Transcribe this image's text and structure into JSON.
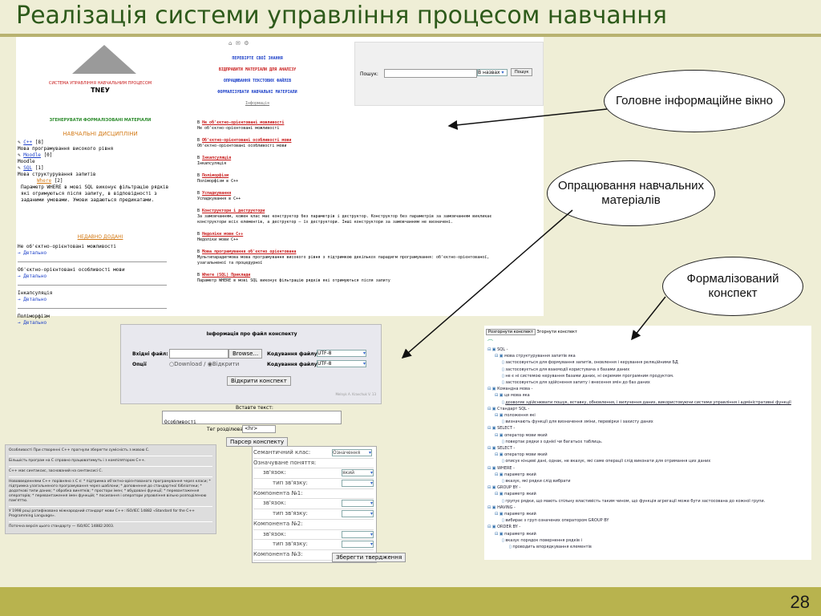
{
  "slide": {
    "title": "Реалізація системи управління процесом навчання",
    "page_number": "28"
  },
  "main_window": {
    "system_title": "СИСТЕМА УПРАВЛІННЯ НАВЧАЛЬНИМ ПРОЦЕСОМ",
    "system_name": "TNEУ",
    "generate_link": "ЗГЕНЕРУВАТИ ФОРМАЛІЗОВАНІ МАТЕРІАЛИ",
    "disciplines_heading": "НАВЧАЛЬНІ ДИСЦИПЛІНИ",
    "disciplines": [
      {
        "name": "C++",
        "count": "[8]",
        "desc": "Мова програмування високого рівня"
      },
      {
        "name": "Moodle",
        "count": "[0]",
        "desc": "Moodle"
      },
      {
        "name": "SQL",
        "count": "[1]",
        "desc": "Мова структурування запитів"
      }
    ],
    "where_title": "Where",
    "where_count": "[2]",
    "where_text": "Параметр WHERE в мові SQL виконує фільтрацію рядків які отримуються після запиту, в відповідності з заданими умовами. Умови задаються предикатами.",
    "recent_heading": "НЕДАВНО ДОДАНІ",
    "recent": [
      "Не об'єктно-орієнтовані можливості",
      "Об'єктно-орієнтовані особливості мови",
      "Інкапсуляція",
      "Поліморфізм"
    ],
    "details_label": "→ Детально",
    "menu": [
      "ПЕРЕВІРТЕ СВОЇ ЗНАННЯ",
      "ВІДПРАВИТИ МАТЕРІАЛИ ДЛЯ АНАЛІЗУ",
      "ОПРАЦЮВАННЯ ТЕКСТОВИХ ФАЙЛІВ",
      "ФОРМАЛІЗУВАТИ НАВЧАЛЬНІ МАТЕРІАЛИ"
    ],
    "info_link": "Інформація",
    "search_label": "Пошук:",
    "search_value": "",
    "search_scope": "В назвах",
    "search_button": "Пошук",
    "topics": [
      {
        "title": "Не об'єктно-орієнтовані можливості",
        "desc": "Не об'єктно-орієнтовані можливості"
      },
      {
        "title": "Об'єктно-орієнтовані особливості мови",
        "desc": "Об'єктно-орієнтовані особливості мови"
      },
      {
        "title": "Інкапсуляція",
        "desc": "Інкапсуляція"
      },
      {
        "title": "Поліморфізм",
        "desc": "Поліморфізм в C++"
      },
      {
        "title": "Успадкування",
        "desc": "Успадкування в C++"
      },
      {
        "title": "Конструктори і деструктори",
        "desc": "За замовчанням, кожен клас має конструктор без параметрів і деструктор. Конструктор без параметрів за замовчанням викликає конструктори всіх елементів, а деструктор — їх деструктори. Інші конструктори за замовчанням не визначені."
      },
      {
        "title": "Недоліки мови C++",
        "desc": "Недоліки мови C++"
      },
      {
        "title": "Мова програмування об'єктно орієнтована",
        "desc": "Мультипарадигмова мова програмування високого рівня з підтримкою декількох парадигм програмування: об'єктно-орієнтованої, узагальненої та процедурної"
      },
      {
        "title": "Where (SQL) Приклади",
        "desc": "Параметр WHERE в мові SQL виконує фільтрацію рядків які отримуються після запиту"
      }
    ]
  },
  "file_info": {
    "title": "Інформація про файл конспекту",
    "file_label": "Вхідні файл:",
    "browse_button": "Browse...",
    "encoding_label": "Кодування файлу:",
    "encoding_value": "UTF-8",
    "options_label": "Опції",
    "option_download": "Download /",
    "option_open": "Відкрити",
    "encoding_label2": "Кодування файлу:",
    "encoding_value2": "UTF-8",
    "open_button": "Відкрити конспект",
    "footer_note": "Melnyk A. Kravchuk V. 13",
    "insert_text_label": "Вставте текст:",
    "insert_text_value": "Особливості",
    "tag_label": "Тег розділювача:",
    "tag_value": "<hr>",
    "parse_button": "Парсер конспекту"
  },
  "notes": [
    "Особливості При створенні C++ прагнули зберегти сумісність з мовою C.",
    "Більшість програм на C справно працюватимуть і з компілятором C++.",
    "C++ має синтаксис, заснований на синтаксисі C.",
    "Нововведеннями C++ порівняно з C є: * підтримка об'єктно-орієнтованого програмування через класи; * підтримка узагальненого програмування через шаблони; * доповнення до стандартної бібліотеки; * додаткові типи даних; * обробка винятків; * простори імен; * вбудовані функції; * перевантаження операторів; * перевантаження імен функцій; * посилання і оператори управління вільно розподіленою пам'яттю.",
    "У 1998 році ратифіковано міжнародний стандарт мови C++: ISO/IEC 14882 «Standard for the C++ Programming Language».",
    "Поточна версія цього стандарту — ISO/IEC 14882:2003."
  ],
  "semantic_form": {
    "rows": [
      {
        "label": "Семантичний клас:",
        "value": "Означення",
        "indent": 0
      },
      {
        "label": "Означуване поняття:",
        "value": "",
        "indent": 0
      },
      {
        "label": "зв'язок:",
        "value": "який",
        "indent": 1
      },
      {
        "label": "тип зв'язку:",
        "value": "",
        "indent": 2
      },
      {
        "label": "Компонента №1:",
        "value": "",
        "indent": 0
      },
      {
        "label": "зв'язок:",
        "value": "",
        "indent": 1
      },
      {
        "label": "тип зв'язку:",
        "value": "",
        "indent": 2
      },
      {
        "label": "Компонента №2:",
        "value": "",
        "indent": 0
      },
      {
        "label": "зв'язок:",
        "value": "",
        "indent": 1
      },
      {
        "label": "тип зв'язку:",
        "value": "",
        "indent": 2
      },
      {
        "label": "Компонента №3:",
        "value": "",
        "indent": 0
      }
    ],
    "save_button": "Зберегти твердження"
  },
  "tree": {
    "expand_button": "Розгорнути конспект",
    "collapse_button": "Згорнути конспект",
    "items": [
      {
        "text": "SQL -",
        "level": 0
      },
      {
        "text": "мова структурування запитів яка",
        "level": 1
      },
      {
        "text": "застосовується для формування запитів, оновлення і керування реляційними БД",
        "level": 2
      },
      {
        "text": "застосовується для взаємодії користувача з базами даних",
        "level": 2
      },
      {
        "text": "не є ні системою керування базами даних, ні окремим програмним продуктом.",
        "level": 2
      },
      {
        "text": "застосовується для здійснення запиту і внесення змін до баз даних",
        "level": 2
      },
      {
        "text": "Командна мова -",
        "level": 0
      },
      {
        "text": "це мова яка",
        "level": 1
      },
      {
        "text": "дозволяє здійснювати пошук, вставку, обновлення, і вилучення даних, використовуючи системи управління і адміністративні функції",
        "level": 2
      },
      {
        "text": "Стандарт SQL -",
        "level": 0
      },
      {
        "text": "положення які",
        "level": 1
      },
      {
        "text": "визначають функції для визначення зміни, перевірки і захисту даних",
        "level": 2
      },
      {
        "text": "SELECT -",
        "level": 0
      },
      {
        "text": "оператор мови який",
        "level": 1
      },
      {
        "text": "повертає рядки з однієї чи багатьох таблиць.",
        "level": 2
      },
      {
        "text": "SELECT -",
        "level": 0
      },
      {
        "text": "оператор мови який",
        "level": 1
      },
      {
        "text": "описує кінцеві дані, однак, не вказує, які саме операції слід виконати для отримання цих даних",
        "level": 2
      },
      {
        "text": "WHERE -",
        "level": 0
      },
      {
        "text": "параметр який",
        "level": 1
      },
      {
        "text": "вказує, які рядки слід вибрати",
        "level": 2
      },
      {
        "text": "GROUP BY -",
        "level": 0
      },
      {
        "text": "параметр який",
        "level": 1
      },
      {
        "text": "групує рядки, що мають спільну властивість таким чином, що функція агрегації може бути застосована до кожної групи.",
        "level": 2
      },
      {
        "text": "HAVING -",
        "level": 0
      },
      {
        "text": "параметр який",
        "level": 1
      },
      {
        "text": "вибирає з груп означених оператором GROUP BY",
        "level": 2
      },
      {
        "text": "ORDER BY -",
        "level": 0
      },
      {
        "text": "параметр який",
        "level": 1
      },
      {
        "text": "вказує порядок повернення рядків і",
        "level": 2
      },
      {
        "text": "проводить впорядкування елементів",
        "level": 3
      }
    ]
  },
  "callouts": {
    "main_window": "Головне інформаційне вікно",
    "processing": "Опрацювання навчальних матеріалів",
    "formalized": "Формалізований конспект"
  }
}
